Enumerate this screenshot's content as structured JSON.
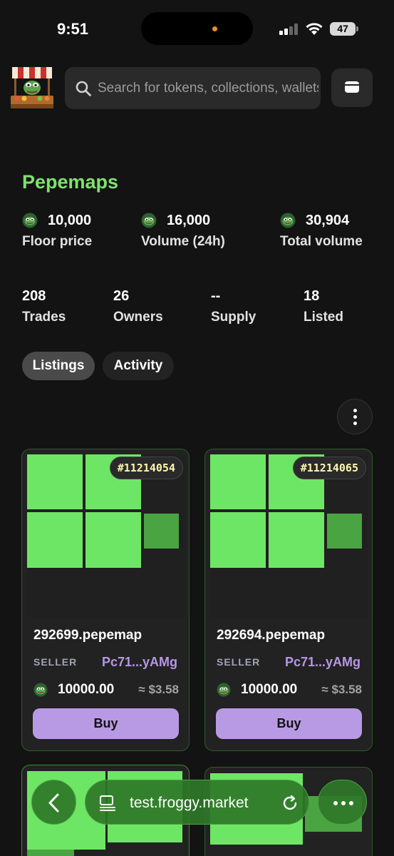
{
  "status_bar": {
    "time": "9:51",
    "battery": "47"
  },
  "search": {
    "placeholder": "Search for tokens, collections, wallets"
  },
  "collection": {
    "name": "Pepemaps",
    "accent_color": "#7ee36c",
    "stats_primary": [
      {
        "value": "10,000",
        "label": "Floor price",
        "icon": "pepe-coin-icon"
      },
      {
        "value": "16,000",
        "label": "Volume (24h)",
        "icon": "pepe-coin-icon"
      },
      {
        "value": "30,904",
        "label": "Total volume",
        "icon": "pepe-coin-icon"
      }
    ],
    "stats_secondary": [
      {
        "value": "208",
        "label": "Trades"
      },
      {
        "value": "26",
        "label": "Owners"
      },
      {
        "value": "--",
        "label": "Supply"
      },
      {
        "value": "18",
        "label": "Listed"
      }
    ]
  },
  "tabs": [
    {
      "label": "Listings",
      "active": true
    },
    {
      "label": "Activity",
      "active": false
    }
  ],
  "listings": [
    {
      "badge": "#11214054",
      "name": "292699.pepemap",
      "seller_label": "SELLER",
      "seller": "Pc71...yAMg",
      "price": "10000.00",
      "price_usd": "≈ $3.58",
      "buy_label": "Buy"
    },
    {
      "badge": "#11214065",
      "name": "292694.pepemap",
      "seller_label": "SELLER",
      "seller": "Pc71...yAMg",
      "price": "10000.00",
      "price_usd": "≈ $3.58",
      "buy_label": "Buy"
    }
  ],
  "browser": {
    "url": "test.froggy.market"
  },
  "colors": {
    "green": "#6ee665",
    "purple": "#b89ae4",
    "background": "#131313"
  }
}
